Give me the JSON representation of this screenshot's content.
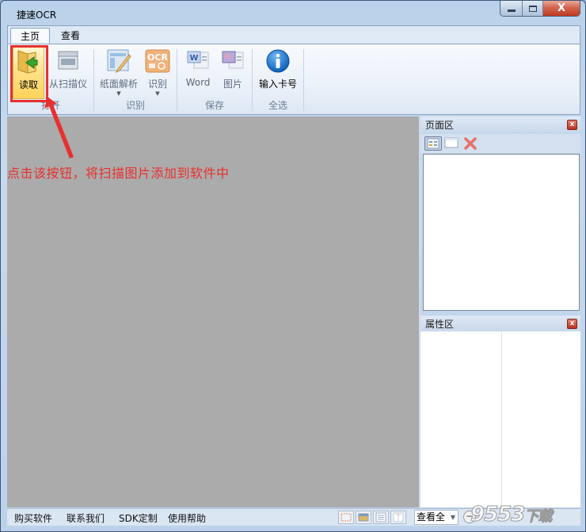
{
  "window": {
    "title": "捷速OCR",
    "controls": {
      "minimize": "—",
      "maximize": "□",
      "close": "X"
    }
  },
  "ribbon": {
    "tabs": [
      {
        "label": "主页",
        "active": true
      },
      {
        "label": "查看",
        "active": false
      }
    ],
    "groups": [
      {
        "label": "打开",
        "buttons": [
          {
            "label": "读取",
            "icon": "folder-import-icon",
            "highlighted": true
          },
          {
            "label": "从扫描仪",
            "icon": "scanner-icon",
            "disabled": true
          }
        ]
      },
      {
        "label": "识别",
        "buttons": [
          {
            "label": "纸面解析",
            "icon": "layout-analysis-icon",
            "dropdown": true,
            "disabled": true
          },
          {
            "label": "识别",
            "icon": "ocr-icon",
            "dropdown": true,
            "disabled": true
          }
        ]
      },
      {
        "label": "保存",
        "buttons": [
          {
            "label": "Word",
            "icon": "word-doc-icon",
            "disabled": true
          },
          {
            "label": "图片",
            "icon": "image-file-icon",
            "disabled": true
          }
        ]
      },
      {
        "label": "全选",
        "buttons": [
          {
            "label": "输入卡号",
            "icon": "info-icon"
          }
        ]
      }
    ]
  },
  "annotation": {
    "text": "点击该按钮，将扫描图片添加到软件中",
    "color": "#e8302f"
  },
  "page_panel": {
    "title": "页面区",
    "close": "x"
  },
  "props_panel": {
    "title": "属性区",
    "close": "x"
  },
  "statusbar": {
    "links": [
      "购买软件",
      "联系我们",
      "SDK定制",
      "使用帮助"
    ],
    "view_mode": "查看全",
    "zoom_out": "−"
  },
  "watermark": {
    "text": "9553",
    "suffix": "下载"
  }
}
